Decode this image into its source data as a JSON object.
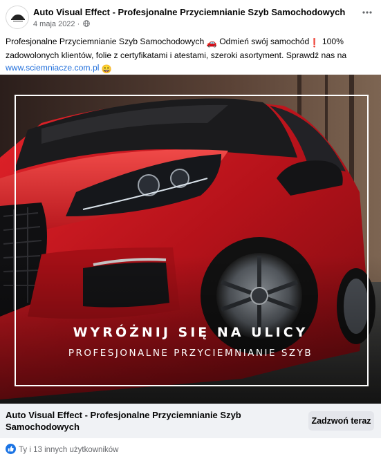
{
  "post": {
    "page_name": "Auto Visual Effect - Profesjonalne Przyciemnianie Szyb Samochodowych",
    "date": "4 maja 2022",
    "separator": "·",
    "privacy_icon": "globe-icon",
    "more_icon": "more-options-icon",
    "text_before_car": "Profesjonalne Przyciemnianie Szyb Samochodowych ",
    "car_emoji": "🚗",
    "text_mid": " Odmień swój samochód",
    "exclamation_emoji": "❗",
    "text_after": " 100% zadowolonych klientów, folie z certyfikatami i atestami, szeroki asortyment. Sprawdź nas na ",
    "link": "www.sciemniacze.com.pl",
    "smile_emoji": "😀"
  },
  "ad_image": {
    "headline": "WYRÓŻNIJ SIĘ NA ULICY",
    "subheadline": "PROFESJONALNE PRZYCIEMNIANIE SZYB"
  },
  "cta": {
    "title": "Auto Visual Effect - Profesjonalne Przyciemnianie Szyb Samochodowych",
    "button_label": "Zadzwoń teraz"
  },
  "reactions": {
    "icon": "like-icon",
    "text": "Ty i 13 innych użytkowników"
  },
  "colors": {
    "link": "#216fdb",
    "cta_bar": "#f0f2f5",
    "button": "#e4e6eb",
    "car_red": "#c8161d"
  }
}
